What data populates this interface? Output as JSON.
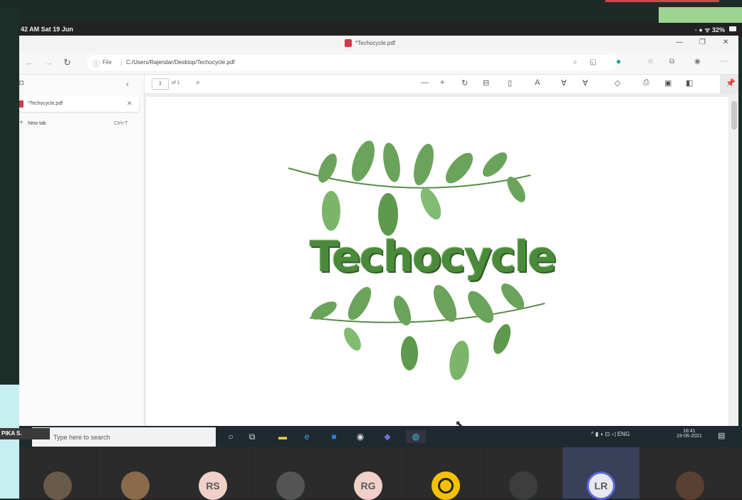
{
  "status_bar": {
    "time": "42 AM  Sat 19 Jun",
    "indicators": "◦ ● ᯤ 32%"
  },
  "browser": {
    "tab_title": "*Techocycle.pdf",
    "address_label": "File",
    "url": "C:/Users/Rajendar/Desktop/Techocycle.pdf",
    "window_controls": {
      "minimize": "—",
      "maximize": "❐",
      "close": "✕"
    }
  },
  "sidebar": {
    "tab_name": "*Techocycle.pdf",
    "new_tab_label": "New tab",
    "new_tab_shortcut": "Ctrl+T"
  },
  "pdf_toolbar": {
    "page": "1",
    "of": "of 1"
  },
  "document": {
    "title": "Techocycle"
  },
  "taskbar": {
    "name_tag": "PIKA S.",
    "search_placeholder": "Type here to search",
    "tray": "^ ▮ ◖ ⊡ ◁  ENG",
    "clock_time": "18:41",
    "clock_date": "19-06-2021"
  },
  "participants": [
    {
      "initials": "",
      "kind": "photo"
    },
    {
      "initials": "",
      "kind": "photo"
    },
    {
      "initials": "RS",
      "kind": "initials"
    },
    {
      "initials": "",
      "kind": "dark"
    },
    {
      "initials": "RG",
      "kind": "initials"
    },
    {
      "initials": "",
      "kind": "yellow"
    },
    {
      "initials": "",
      "kind": "dark"
    },
    {
      "initials": "LR",
      "kind": "initials-active"
    },
    {
      "initials": "",
      "kind": "photo"
    }
  ],
  "colors": {
    "brand_green": "#4c8a3b",
    "pdf_red": "#d1374a",
    "active_ring": "#5b68d8"
  }
}
